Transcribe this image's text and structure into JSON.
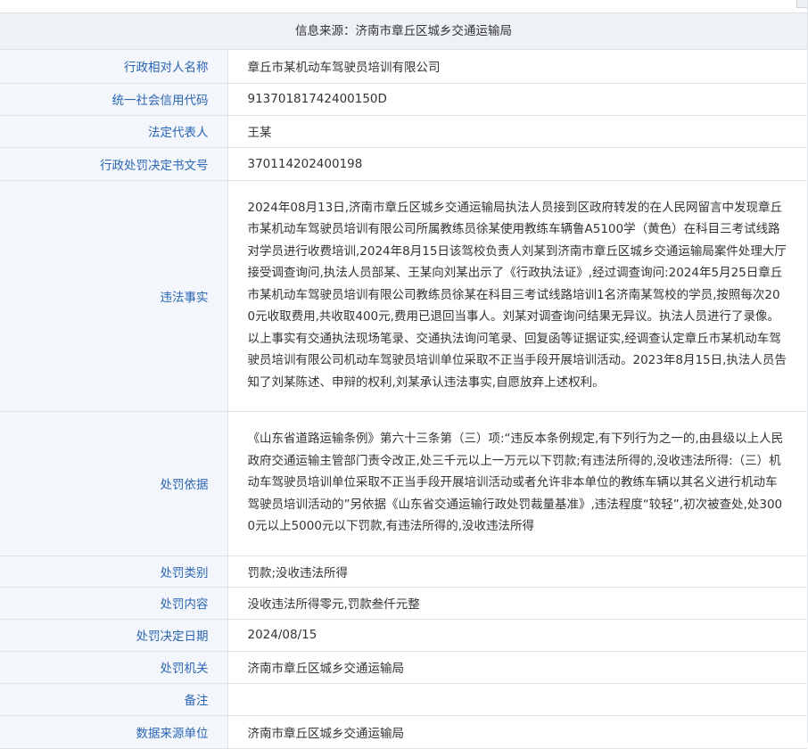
{
  "header": {
    "source_text": "信息来源：济南市章丘区城乡交通运输局"
  },
  "rows": [
    {
      "label": "行政相对人名称",
      "value": "章丘市某机动车驾驶员培训有限公司"
    },
    {
      "label": "统一社会信用代码",
      "value": "91370181742400150D"
    },
    {
      "label": "法定代表人",
      "value": "王某"
    },
    {
      "label": "行政处罚决定书文号",
      "value": "370114202400198"
    },
    {
      "label": "违法事实",
      "value": "2024年08月13日,济南市章丘区城乡交通运输局执法人员接到区政府转发的在人民网留言中发现章丘市某机动车驾驶员培训有限公司所属教练员徐某使用教练车辆鲁A5100学（黄色）在科目三考试线路对学员进行收费培训,2024年8月15日该驾校负责人刘某到济南市章丘区城乡交通运输局案件处理大厅接受调查询问,执法人员部某、王某向刘某出示了《行政执法证》,经过调查询问:2024年5月25日章丘市某机动车驾驶员培训有限公司教练员徐某在科目三考试线路培训1名济南某驾校的学员,按照每次200元收取费用,共收取400元,费用已退回当事人。刘某对调查询问结果无异议。执法人员进行了录像。以上事实有交通执法现场笔录、交通执法询问笔录、回复函等证据证实,经调查认定章丘市某机动车驾驶员培训有限公司机动车驾驶员培训单位采取不正当手段开展培训活动。2023年8月15日,执法人员告知了刘某陈述、申辩的权利,刘某承认违法事实,自愿放弃上述权利。"
    },
    {
      "label": "处罚依据",
      "value": "《山东省道路运输条例》第六十三条第（三）项:“违反本条例规定,有下列行为之一的,由县级以上人民政府交通运输主管部门责令改正,处三千元以上一万元以下罚款;有违法所得的,没收违法所得:（三）机动车驾驶员培训单位采取不正当手段开展培训活动或者允许非本单位的教练车辆以其名义进行机动车驾驶员培训活动的”另依据《山东省交通运输行政处罚裁量基准》,违法程度“较轻”,初次被查处,处3000元以上5000元以下罚款,有违法所得的,没收违法所得"
    },
    {
      "label": "处罚类别",
      "value": "罚款;没收违法所得"
    },
    {
      "label": "处罚内容",
      "value": "没收违法所得零元,罚款叁仟元整"
    },
    {
      "label": "处罚决定日期",
      "value": "2024/08/15"
    },
    {
      "label": "处罚机关",
      "value": "济南市章丘区城乡交通运输局"
    },
    {
      "label": "备注",
      "value": ""
    },
    {
      "label": "数据来源单位",
      "value": "济南市章丘区城乡交通运输局"
    }
  ]
}
